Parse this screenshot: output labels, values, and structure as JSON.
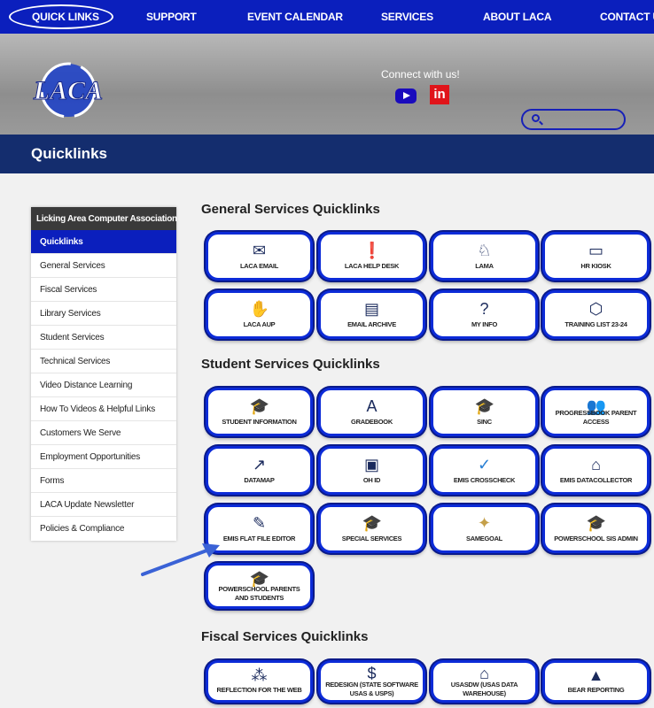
{
  "nav": {
    "items": [
      "QUICK LINKS",
      "SUPPORT",
      "EVENT CALENDAR",
      "SERVICES",
      "ABOUT LACA",
      "CONTACT US"
    ]
  },
  "header": {
    "logo_text": "LACA",
    "connect": "Connect with us!",
    "linkedin": "in"
  },
  "title": "Quicklinks",
  "sidebar": {
    "heading": "Licking Area Computer Association",
    "items": [
      "Quicklinks",
      "General Services",
      "Fiscal Services",
      "Library Services",
      "Student Services",
      "Technical Services",
      "Video Distance Learning",
      "How To Videos & Helpful Links",
      "Customers We Serve",
      "Employment Opportunities",
      "Forms",
      "LACA Update Newsletter",
      "Policies & Compliance"
    ]
  },
  "sections": {
    "general": "General Services Quicklinks",
    "student": "Student Services Quicklinks",
    "fiscal": "Fiscal Services Quicklinks"
  },
  "tiles": {
    "general": [
      "LACA EMAIL",
      "LACA HELP DESK",
      "LAMA",
      "HR KIOSK",
      "LACA AUP",
      "EMAIL ARCHIVE",
      "MY INFO",
      "TRAINING LIST 23-24"
    ],
    "student": [
      "STUDENT INFORMATION",
      "GRADEBOOK",
      "SINC",
      "PROGRESSBOOK PARENT ACCESS",
      "DATAMAP",
      "OH ID",
      "EMIS CROSSCHECK",
      "EMIS DATACOLLECTOR",
      "EMIS FLAT FILE EDITOR",
      "SPECIAL SERVICES",
      "SAMEGOAL",
      "POWERSCHOOL SIS ADMIN",
      "POWERSCHOOL PARENTS AND STUDENTS"
    ],
    "fiscal": [
      "REFLECTION FOR THE WEB",
      "REDESIGN (STATE SOFTWARE USAS & USPS)",
      "USASDW (USAS DATA WAREHOUSE)",
      "BEAR REPORTING"
    ]
  },
  "colors": {
    "nav_bg": "#0b1fbd",
    "title_bg": "#142d6e",
    "tile_border": "#0c2bd8",
    "arrow": "#3a62d6"
  }
}
